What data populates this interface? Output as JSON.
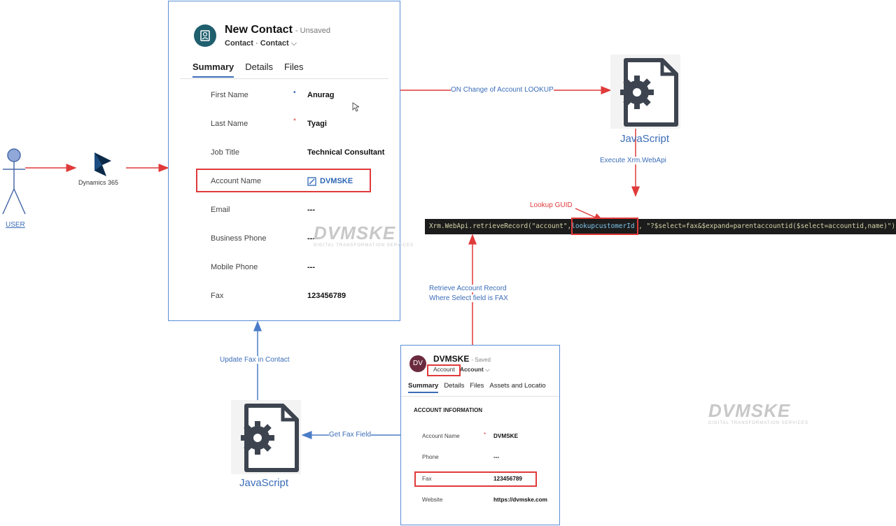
{
  "user": {
    "label": "USER"
  },
  "dynamics": {
    "label": "Dynamics 365"
  },
  "contact_form": {
    "title": "New Contact",
    "status": "- Unsaved",
    "subtitle_entity": "Contact",
    "subtitle_separator": "·",
    "subtitle_form": "Contact",
    "tabs": [
      "Summary",
      "Details",
      "Files"
    ],
    "fields": [
      {
        "label": "First Name",
        "required": "•",
        "value": "Anurag"
      },
      {
        "label": "Last Name",
        "required": "*",
        "value": "Tyagi"
      },
      {
        "label": "Job Title",
        "required": "",
        "value": "Technical Consultant"
      },
      {
        "label": "Account Name",
        "required": "",
        "value": "DVMSKE"
      },
      {
        "label": "Email",
        "required": "",
        "value": "---"
      },
      {
        "label": "Business Phone",
        "required": "",
        "value": "---"
      },
      {
        "label": "Mobile Phone",
        "required": "",
        "value": "---"
      },
      {
        "label": "Fax",
        "required": "",
        "value": "123456789"
      }
    ]
  },
  "arrows": {
    "onchange": "ON Change of Account LOOKUP",
    "execute": "Execute Xrm.WebApi",
    "retrieve_line1": "Retrieve Account Record",
    "retrieve_line2": "Where Select field is FAX",
    "update_fax": "Update Fax in Contact",
    "get_fax": "Get Fax Field"
  },
  "javascript_top": {
    "label": "JavaScript"
  },
  "javascript_bottom": {
    "label": "JavaScript"
  },
  "lookup_guid": {
    "label": "Lookup GUID"
  },
  "code": {
    "part1": "Xrm.WebApi.retrieveRecord(\"account\",",
    "part2": "lookupcustomerId",
    "part3": " , \"?$select=fax&$expand=parentaccountid($select=accountid,name)\")"
  },
  "account_form": {
    "avatar": "DV",
    "title": "DVMSKE",
    "status": "- Saved",
    "subtitle_entity": "Account",
    "subtitle_form": "Account",
    "tabs": [
      "Summary",
      "Details",
      "Files",
      "Assets and Locatio"
    ],
    "section": "ACCOUNT INFORMATION",
    "fields": [
      {
        "label": "Account Name",
        "required": "*",
        "value": "DVMSKE"
      },
      {
        "label": "Phone",
        "required": "",
        "value": "---"
      },
      {
        "label": "Fax",
        "required": "",
        "value": "123456789"
      },
      {
        "label": "Website",
        "required": "",
        "value": "https://dvmske.com"
      }
    ]
  },
  "watermark": {
    "text": "DVMSKE",
    "subtext": "DIGITAL TRANSFORMATION SERVICES"
  },
  "colors": {
    "arrow_red": "#e03a3a",
    "arrow_blue": "#4a7cc7",
    "label_blue": "#3b6db8",
    "panel_border": "#5b8fd6"
  },
  "icons": [
    "user-icon",
    "dynamics365-logo",
    "javascript-file-gear-icon",
    "cursor-icon"
  ]
}
